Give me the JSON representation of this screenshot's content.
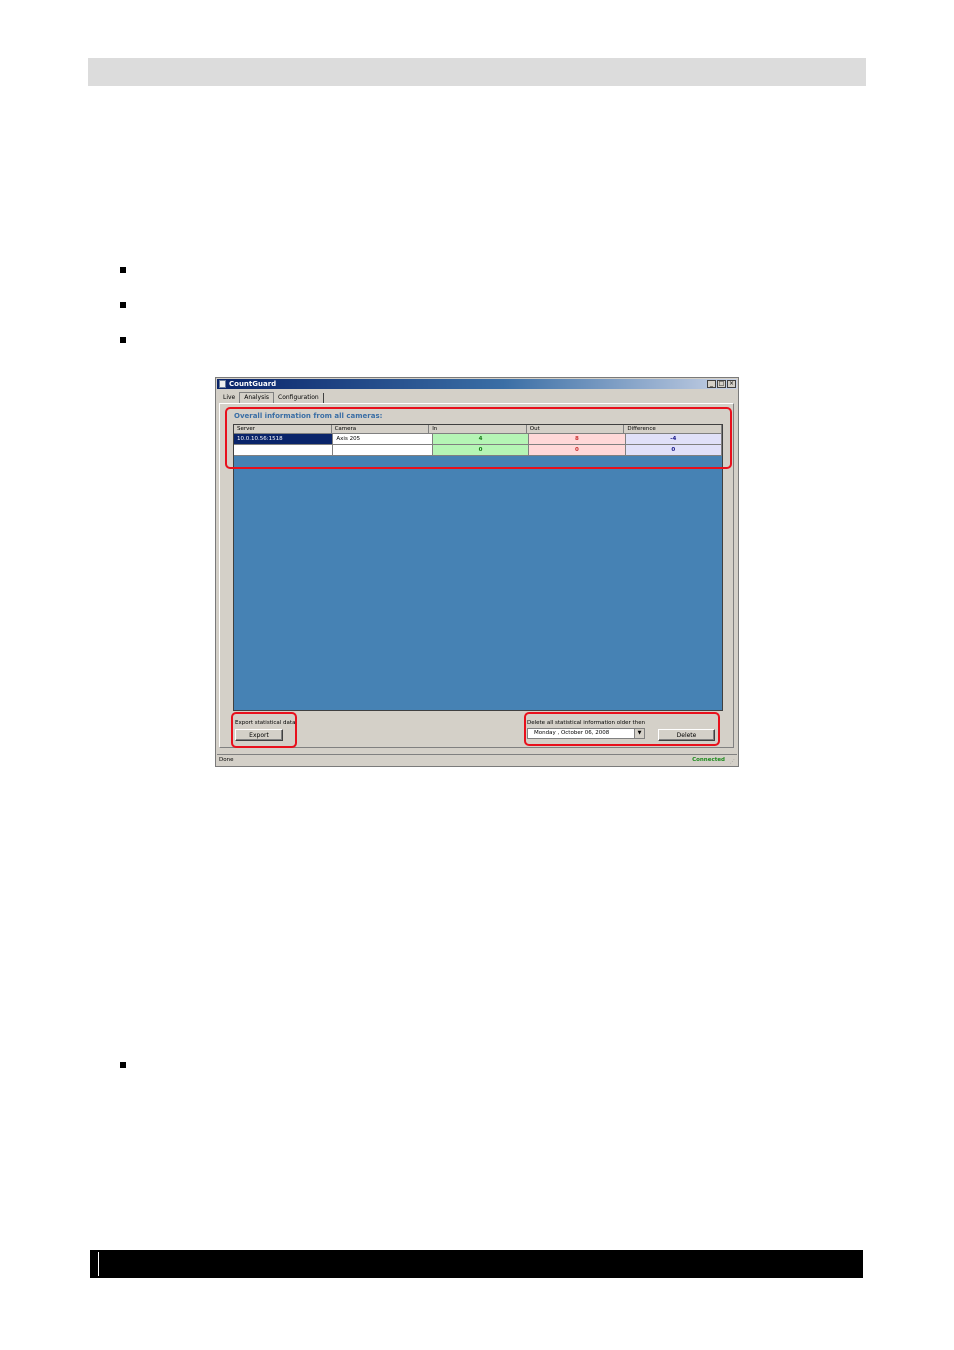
{
  "window": {
    "title": "CountGuard",
    "minimize": "_",
    "maximize": "□",
    "close": "×"
  },
  "tabs": [
    {
      "label": "Live"
    },
    {
      "label": "Analysis"
    },
    {
      "label": "Configuration"
    }
  ],
  "overall_title": "Overall information from all cameras:",
  "table": {
    "headers": [
      "Server",
      "Camera",
      "In",
      "Out",
      "Difference"
    ],
    "rows": [
      [
        "10.0.10.56:1518",
        "Axis 205",
        "4",
        "8",
        "-4"
      ],
      [
        "",
        "",
        "0",
        "0",
        "0"
      ]
    ]
  },
  "export": {
    "label": "Export statistical data",
    "button": "Export"
  },
  "delete": {
    "label": "Delete all statistical information older then",
    "date_value": "Monday   ,   October   06, 2008",
    "dropdown_icon": "chevron-down-icon",
    "button": "Delete"
  },
  "status": {
    "left": "Done",
    "right": "Connected",
    "grip": "⋰"
  },
  "colors": {
    "title_gradient_start": "#0a246a",
    "grid_background": "#4682b4",
    "in_cell": "#b5f5b5",
    "out_cell": "#ffd8d8",
    "diff_cell": "#e0e0f8",
    "highlight": "#e8101c",
    "connected": "#1b8a1b"
  }
}
